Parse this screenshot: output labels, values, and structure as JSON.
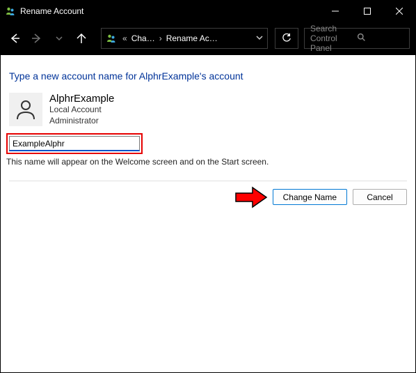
{
  "window": {
    "title": "Rename Account"
  },
  "breadcrumb": {
    "crumb1": "Cha…",
    "crumb2": "Rename Ac…"
  },
  "search": {
    "placeholder": "Search Control Panel"
  },
  "page": {
    "heading": "Type a new account name for AlphrExample's account",
    "user_name": "AlphrExample",
    "account_type": "Local Account",
    "role": "Administrator",
    "input_value": "ExampleAlphr",
    "hint": "This name will appear on the Welcome screen and on the Start screen.",
    "primary_button": "Change Name",
    "secondary_button": "Cancel"
  }
}
